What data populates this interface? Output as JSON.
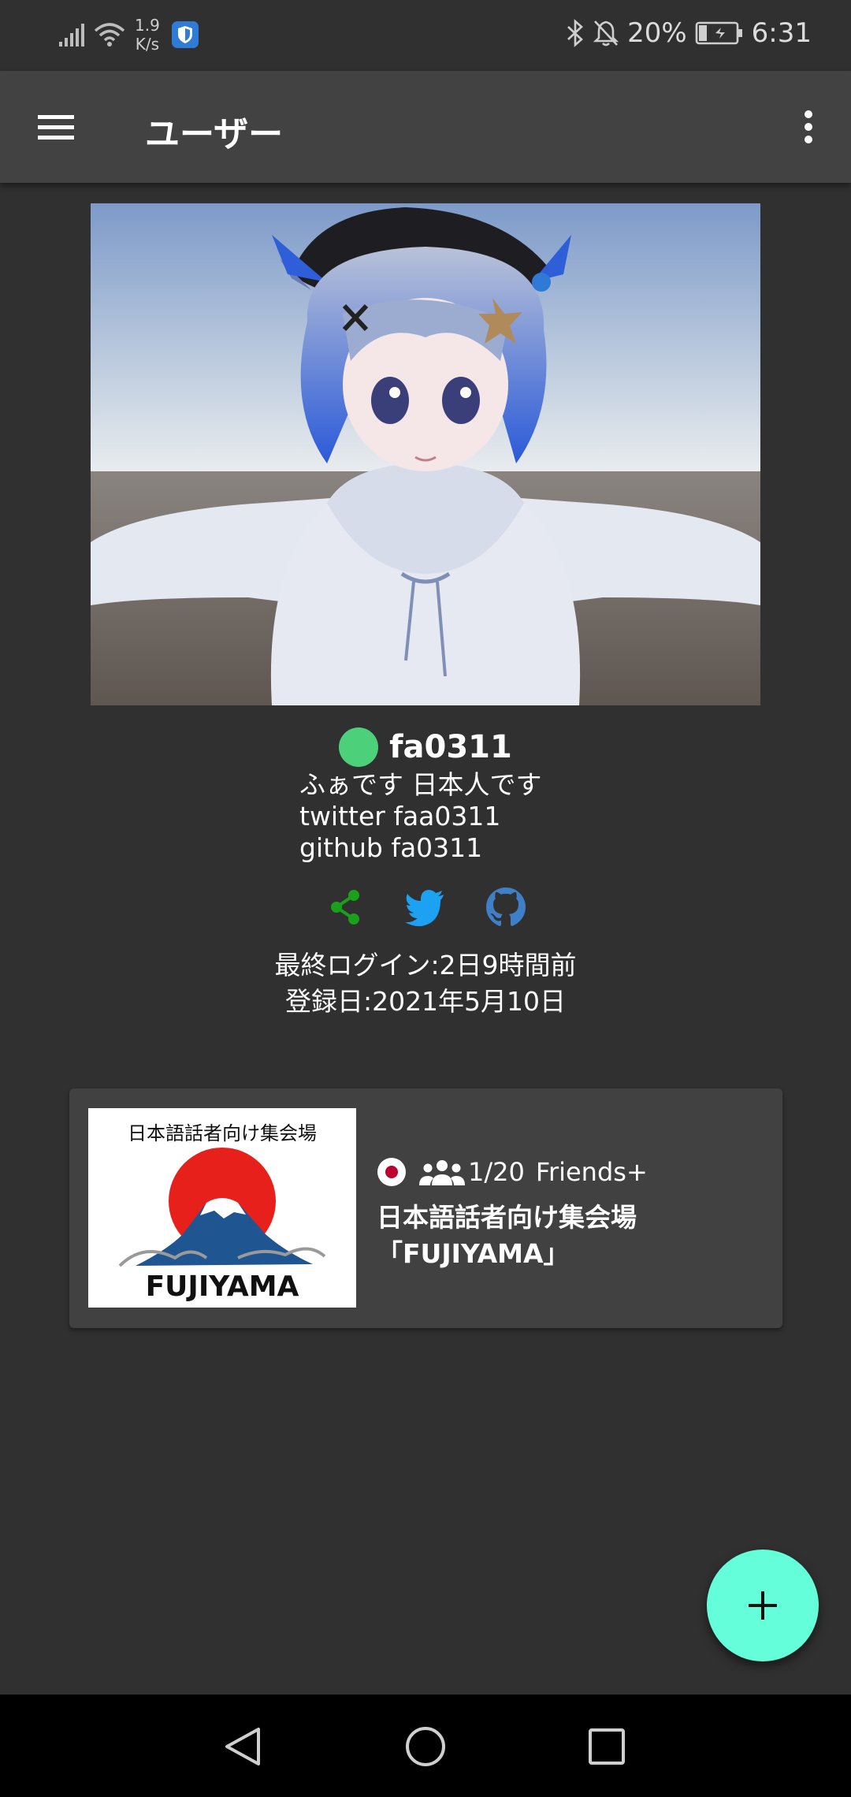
{
  "status_bar": {
    "net_speed_value": "1.9",
    "net_speed_unit": "K/s",
    "battery": "20%",
    "time": "6:31"
  },
  "app_bar": {
    "title": "ユーザー",
    "menu_icon": "hamburger-menu-icon",
    "more_icon": "more-vert-icon"
  },
  "profile": {
    "username": "fa0311",
    "status_color": "#4cd07a",
    "bio_lines": [
      "ふぁです 日本人です",
      "twitter faa0311",
      "github fa0311"
    ],
    "social_icons": [
      "share-icon",
      "twitter-icon",
      "github-icon"
    ],
    "last_login": "最終ログイン:2日9時間前",
    "registered": "登録日:2021年5月10日"
  },
  "world": {
    "thumbnail_title": "日本語話者向け集会場",
    "thumbnail_logo": "FUJIYAMA",
    "players": "1/20",
    "access": "Friends+",
    "name_line1": "日本語話者向け集会場",
    "name_line2": "「FUJIYAMA」"
  },
  "fab": {
    "icon": "plus-icon"
  },
  "nav_bar": [
    "back-icon",
    "home-icon",
    "recents-icon"
  ],
  "colors": {
    "background": "#303030",
    "app_bar": "#424242",
    "fab": "#64ffda",
    "share": "#1aa01a",
    "twitter": "#1da1f2",
    "github": "#3f7fc8"
  }
}
